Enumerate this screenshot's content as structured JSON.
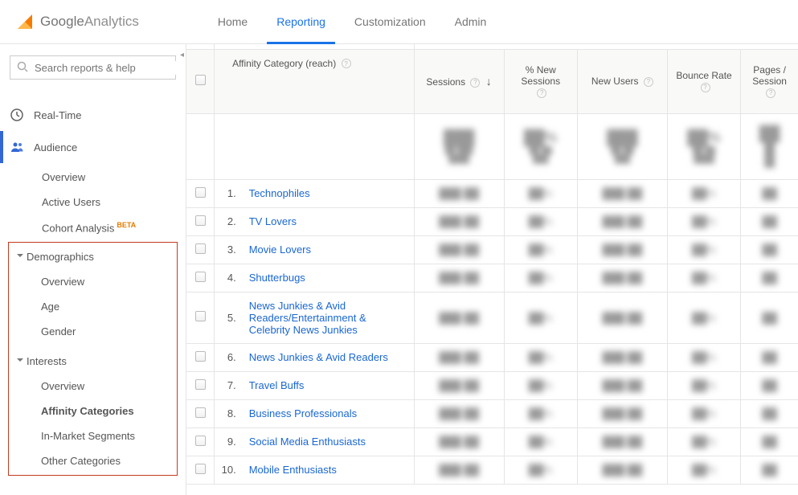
{
  "header": {
    "brand_google": "Google",
    "brand_analytics": " Analytics",
    "tabs": [
      {
        "label": "Home"
      },
      {
        "label": "Reporting",
        "active": true
      },
      {
        "label": "Customization"
      },
      {
        "label": "Admin"
      }
    ]
  },
  "sidebar": {
    "search_placeholder": "Search reports & help",
    "sections": {
      "realtime": "Real-Time",
      "audience": "Audience"
    },
    "audience_items": {
      "overview": "Overview",
      "active_users": "Active Users",
      "cohort": "Cohort Analysis",
      "cohort_beta": "BETA"
    },
    "demographics": {
      "header": "Demographics",
      "overview": "Overview",
      "age": "Age",
      "gender": "Gender"
    },
    "interests": {
      "header": "Interests",
      "overview": "Overview",
      "affinity": "Affinity Categories",
      "inmarket": "In-Market Segments",
      "other": "Other Categories"
    }
  },
  "table": {
    "dimension_header": "Affinity Category (reach)",
    "columns": {
      "sessions": "Sessions",
      "pct_new": "% New Sessions",
      "new_users": "New Users",
      "bounce": "Bounce Rate",
      "pps": "Pages / Session"
    },
    "rows": [
      {
        "idx": "1.",
        "name": "Technophiles"
      },
      {
        "idx": "2.",
        "name": "TV Lovers"
      },
      {
        "idx": "3.",
        "name": "Movie Lovers"
      },
      {
        "idx": "4.",
        "name": "Shutterbugs"
      },
      {
        "idx": "5.",
        "name": "News Junkies & Avid Readers/Entertainment & Celebrity News Junkies"
      },
      {
        "idx": "6.",
        "name": "News Junkies & Avid Readers"
      },
      {
        "idx": "7.",
        "name": "Travel Buffs"
      },
      {
        "idx": "8.",
        "name": "Business Professionals"
      },
      {
        "idx": "9.",
        "name": "Social Media Enthusiasts"
      },
      {
        "idx": "10.",
        "name": "Mobile Enthusiasts"
      }
    ]
  }
}
